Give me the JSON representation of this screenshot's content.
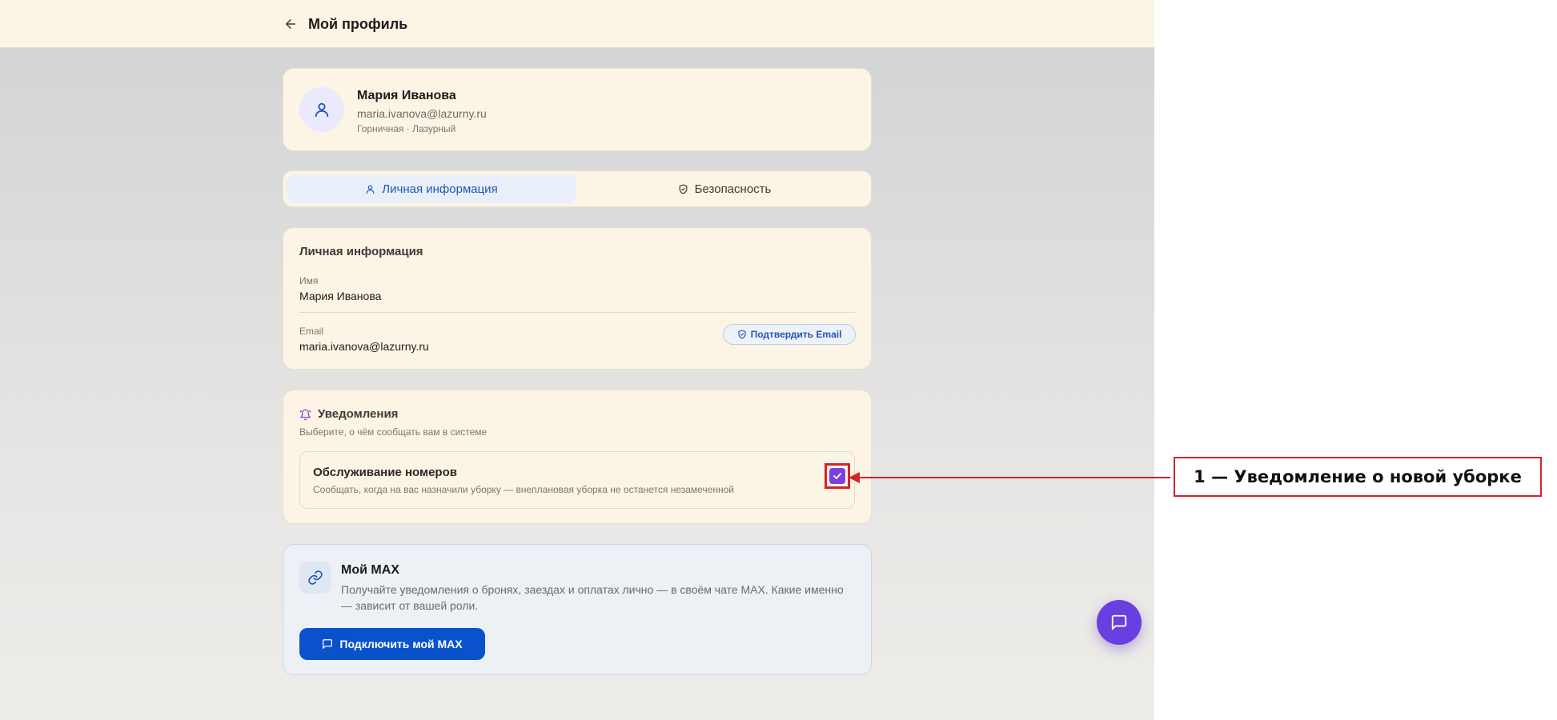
{
  "header": {
    "title": "Мой профиль",
    "back_icon": "arrow-left-icon"
  },
  "profile": {
    "name": "Мария Иванова",
    "email": "maria.ivanova@lazurny.ru",
    "role": "Горничная · Лазурный",
    "avatar_icon": "user-icon"
  },
  "tabs": [
    {
      "label": "Личная информация",
      "icon": "user-icon",
      "active": true
    },
    {
      "label": "Безопасность",
      "icon": "shield-icon",
      "active": false
    }
  ],
  "personal_info": {
    "title": "Личная информация",
    "name_label": "Имя",
    "name_value": "Мария Иванова",
    "email_label": "Email",
    "email_value": "maria.ivanova@lazurny.ru",
    "verify_label": "Подтвердить Email"
  },
  "notifications": {
    "title": "Уведомления",
    "subtitle": "Выберите, о чём сообщать вам в системе",
    "icon": "bell-icon",
    "items": [
      {
        "title": "Обслуживание номеров",
        "description": "Сообщать, когда на вас назначили уборку — внеплановая уборка не останется незамеченной",
        "checked": true
      }
    ]
  },
  "max": {
    "title": "Мой MAX",
    "description": "Получайте уведомления о бронях, заездах и оплатах лично — в своём чате MAX. Какие именно — зависит от вашей роли.",
    "button_label": "Подключить мой MAX",
    "icon": "link-icon"
  },
  "annotation": {
    "label": "1 — Уведомление о новой уборке"
  },
  "colors": {
    "accent": "#2156b6",
    "primary_button": "#0a52cc",
    "checkbox": "#7b3fe4",
    "fab": "#6a3fe0",
    "annotation": "#d1242b"
  }
}
